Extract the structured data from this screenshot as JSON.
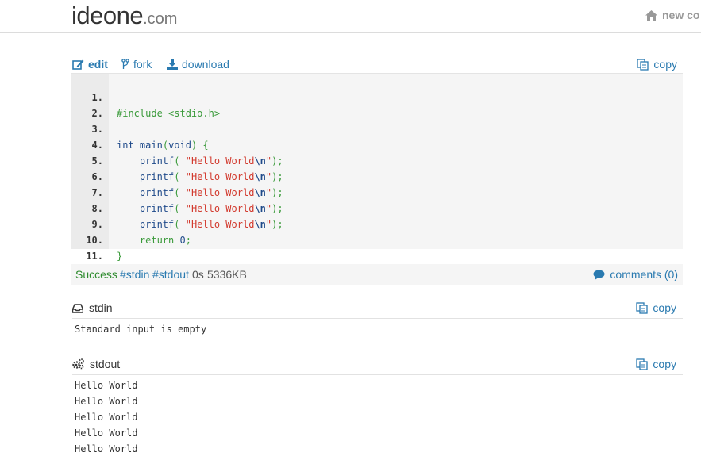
{
  "header": {
    "logo_main": "ideone",
    "logo_suffix": ".com",
    "new_code_label": "new co"
  },
  "toolbar": {
    "edit_label": "edit",
    "fork_label": "fork",
    "download_label": "download",
    "copy_label": "copy"
  },
  "code": {
    "language": "c",
    "line_numbers": [
      "1.",
      "2.",
      "3.",
      "4.",
      "5.",
      "6.",
      "7.",
      "8.",
      "9.",
      "10.",
      "11."
    ],
    "lines": [
      "#include <stdio.h>",
      "",
      "int main(void) {",
      "    printf( \"Hello World\\n\");",
      "    printf( \"Hello World\\n\");",
      "    printf( \"Hello World\\n\");",
      "    printf( \"Hello World\\n\");",
      "    printf( \"Hello World\\n\");",
      "    return 0;",
      "}",
      ""
    ]
  },
  "status": {
    "result": "Success",
    "tag_stdin": "#stdin",
    "tag_stdout": "#stdout",
    "time": "0s",
    "memory": "5336KB",
    "comments_label": "comments (0)"
  },
  "stdin": {
    "title": "stdin",
    "copy_label": "copy",
    "content": "Standard input is empty"
  },
  "stdout": {
    "title": "stdout",
    "copy_label": "copy",
    "lines": [
      "Hello World",
      "Hello World",
      "Hello World",
      "Hello World",
      "Hello World"
    ]
  },
  "colors": {
    "link": "#2a7ab0",
    "success": "#2e8b2e",
    "string": "#d23a2e",
    "keyword": "#1f4a8a",
    "preprocessor": "#3a9a3a"
  }
}
